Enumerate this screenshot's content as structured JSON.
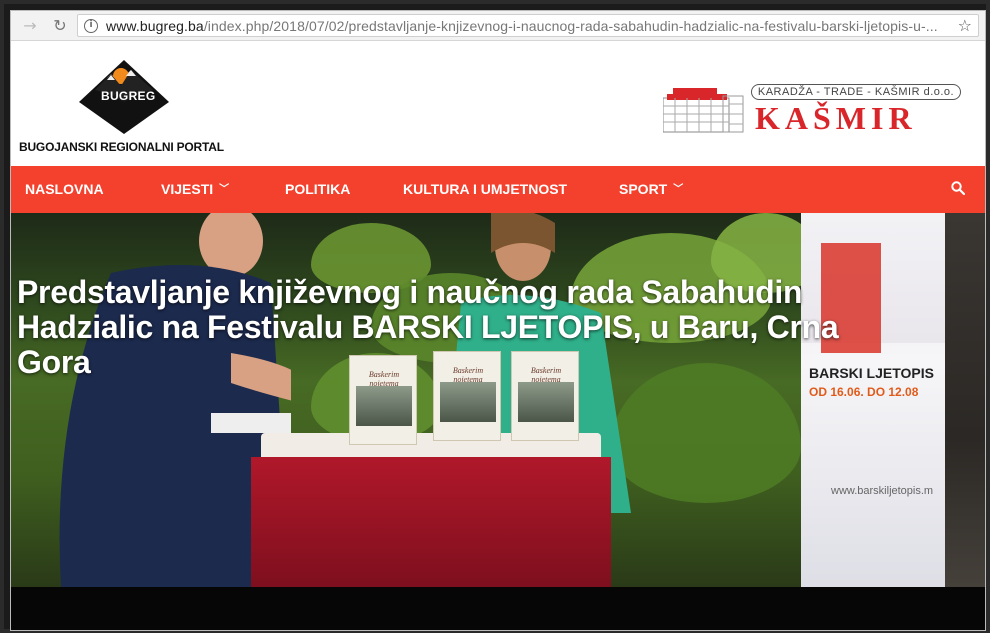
{
  "browser": {
    "url_domain": "www.bugreg.ba",
    "url_path": "/index.php/2018/07/02/predstavljanje-knjizevnog-i-naucnog-rada-sabahudin-hadzialic-na-festivalu-barski-ljetopis-u-..."
  },
  "header": {
    "logo_badge": "BUGREG",
    "logo_subtitle": "BUGOJANSKI REGIONALNI PORTAL",
    "ad": {
      "topline": "KARADŽA - TRADE - KAŠMIR d.o.o.",
      "brand": "KAŠMIR"
    }
  },
  "nav": {
    "items": [
      {
        "label": "NASLOVNA",
        "has_dropdown": false
      },
      {
        "label": "VIJESTI",
        "has_dropdown": true
      },
      {
        "label": "POLITIKA",
        "has_dropdown": false
      },
      {
        "label": "KULTURA I UMJETNOST",
        "has_dropdown": false
      },
      {
        "label": "SPORT",
        "has_dropdown": true
      }
    ],
    "search_icon": "search-icon"
  },
  "hero": {
    "title": "Predstavljanje književnog i naučnog rada Sabahudin Hadzialic na Festivalu BARSKI LJETOPIS, u Baru, Crna Gora",
    "banner_text": "BARSKI LJETOPIS",
    "banner_date": "OD 16.06. DO 12.08",
    "banner_url": "www.barskiljetopis.m",
    "book_title": "Baskerim nojetema"
  },
  "colors": {
    "nav_bg": "#f4412e",
    "brand_red": "#d8262a"
  }
}
